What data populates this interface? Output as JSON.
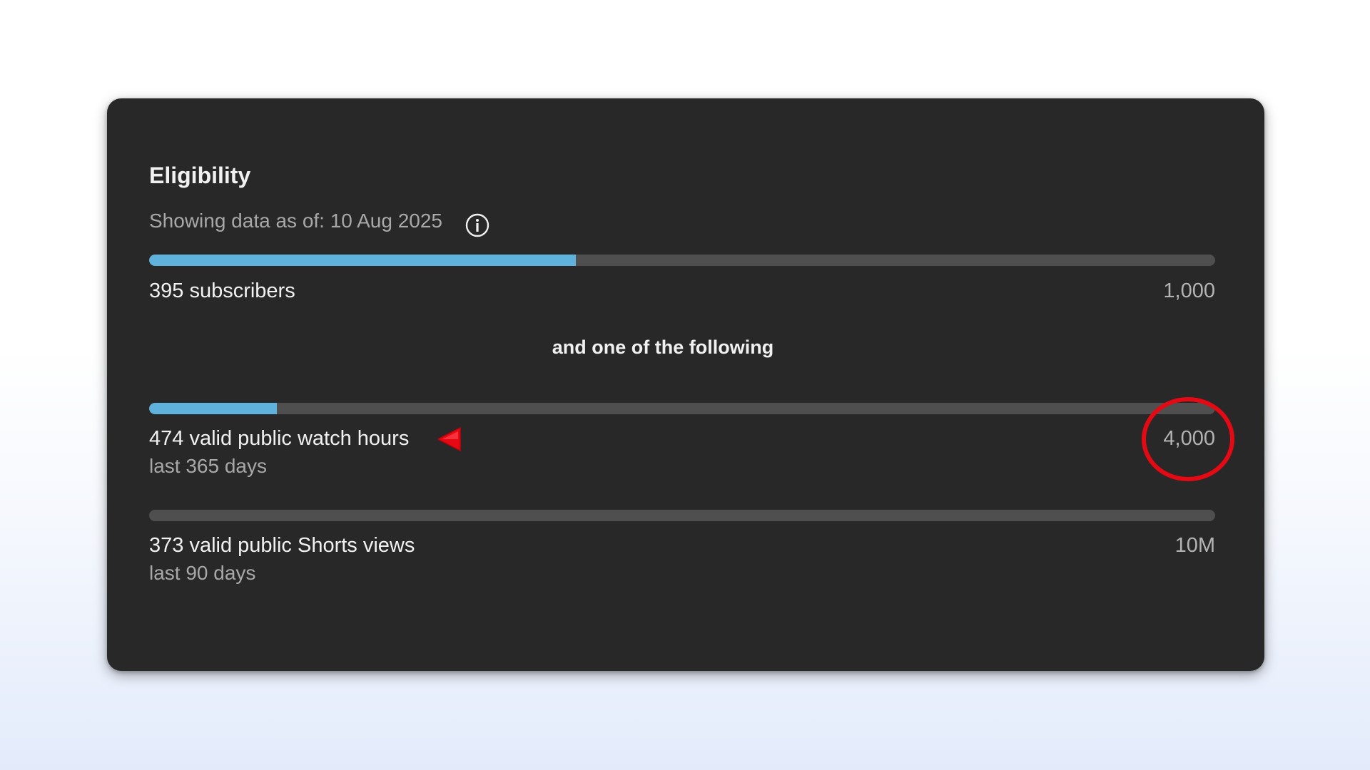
{
  "card": {
    "title": "Eligibility",
    "as_of": "Showing data as of: 10 Aug 2025",
    "info_icon": "info-icon",
    "divider": "and one of the following"
  },
  "requirements": [
    {
      "label": "395 subscribers",
      "sublabel": "",
      "current": 395,
      "target_label": "1,000",
      "target": 1000,
      "progress_fraction": 0.4
    },
    {
      "label": "474 valid public watch hours",
      "sublabel": "last 365 days",
      "current": 474,
      "target_label": "4,000",
      "target": 4000,
      "progress_fraction": 0.12
    },
    {
      "label": "373 valid public Shorts views",
      "sublabel": "last 90 days",
      "current": 373,
      "target_label": "10M",
      "target": 10000000,
      "progress_fraction": 0.0
    }
  ],
  "annotations": {
    "arrow_icon": "red-arrow-icon",
    "circle_icon": "red-circle-highlight-icon",
    "color": "#e50914"
  },
  "colors": {
    "card_background": "#282828",
    "progress_fill": "#5fb2dc",
    "progress_track": "#4f4f4f"
  }
}
